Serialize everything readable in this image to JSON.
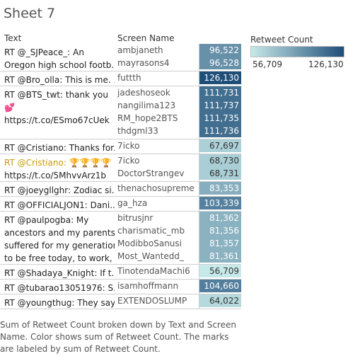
{
  "sheet_title": "Sheet 7",
  "headers": {
    "text": "Text",
    "screen_name": "Screen Name"
  },
  "legend": {
    "title": "Retweet Count",
    "min_label": "56,709",
    "max_label": "126,130",
    "color_low": "#c7e9e9",
    "color_high": "#1f4e79"
  },
  "chart_data": {
    "type": "table",
    "min": 56709,
    "max": 126130,
    "groups": [
      {
        "text_lines": [
          "RT @_SJPeace_: An",
          "Oregon high school footb.."
        ],
        "rows": [
          {
            "name": "ambjaneth",
            "value": 96522,
            "label": "96,522"
          },
          {
            "name": "mayrasons4",
            "value": 96528,
            "label": "96,528"
          }
        ]
      },
      {
        "text_lines": [
          "RT @Bro_olla: This is me. .."
        ],
        "rows": [
          {
            "name": "futtth",
            "value": 126130,
            "label": "126,130"
          }
        ]
      },
      {
        "text_lines": [
          "RT @BTS_twt: thank you",
          "💕",
          "https://t.co/ESmo67cUek"
        ],
        "rows": [
          {
            "name": "jadeshoseok",
            "value": 111731,
            "label": "111,731"
          },
          {
            "name": "nangilima123",
            "value": 111737,
            "label": "111,737"
          },
          {
            "name": "RM_hope2BTS",
            "value": 111735,
            "label": "111,735"
          },
          {
            "name": "thdgml33",
            "value": 111736,
            "label": "111,736"
          }
        ]
      },
      {
        "text_lines": [
          "RT @Cristiano: Thanks for.."
        ],
        "rows": [
          {
            "name": "7icko",
            "value": 67697,
            "label": "67,697"
          }
        ]
      },
      {
        "text_lines": [
          "RT @Cristiano: 🏆🏆🏆🏆",
          "https://t.co/5MhvvArz1b"
        ],
        "rows": [
          {
            "name": "7icko",
            "value": 68730,
            "label": "68,730"
          },
          {
            "name": "DoctorStrangev",
            "value": 68731,
            "label": "68,731"
          }
        ]
      },
      {
        "text_lines": [
          "RT @joeygllghr: Zodiac si.."
        ],
        "rows": [
          {
            "name": "thenachosupreme",
            "value": 83353,
            "label": "83,353"
          }
        ]
      },
      {
        "text_lines": [
          "RT @OFFICIALJON1: Dani.."
        ],
        "rows": [
          {
            "name": "ga_hza",
            "value": 103339,
            "label": "103,339"
          }
        ]
      },
      {
        "text_lines": [
          "RT @paulpogba: My",
          "ancestors and my parents",
          "suffered for my generation",
          "to be free today, to work, .."
        ],
        "rows": [
          {
            "name": "bitrusjnr",
            "value": 81362,
            "label": "81,362"
          },
          {
            "name": "charismatic_mb",
            "value": 81356,
            "label": "81,356"
          },
          {
            "name": "ModibboSanusi",
            "value": 81357,
            "label": "81,357"
          },
          {
            "name": "Most_Wantedd_",
            "value": 81361,
            "label": "81,361"
          }
        ]
      },
      {
        "text_lines": [
          "RT @Shadaya_Knight: If t.."
        ],
        "rows": [
          {
            "name": "TinotendaMachi6",
            "value": 56709,
            "label": "56,709"
          }
        ]
      },
      {
        "text_lines": [
          "RT @tubarao13051976: S.."
        ],
        "rows": [
          {
            "name": "isamhoffmann",
            "value": 104660,
            "label": "104,660"
          }
        ]
      },
      {
        "text_lines": [
          "RT @youngthug: They say.."
        ],
        "rows": [
          {
            "name": "EXTENDOSLUMP",
            "value": 64022,
            "label": "64,022"
          }
        ]
      }
    ]
  },
  "caption": "Sum of Retweet Count broken down by Text and Screen Name.  Color shows sum of Retweet Count.  The marks are labeled by sum of Retweet Count."
}
